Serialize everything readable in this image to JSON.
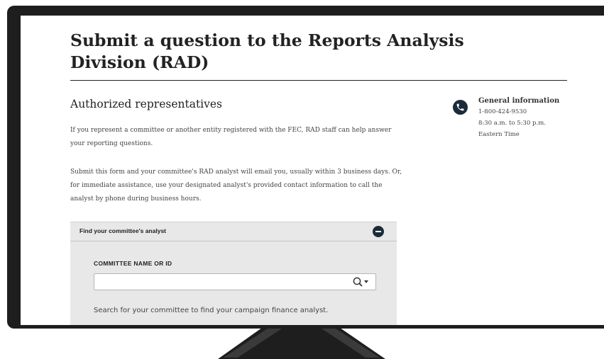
{
  "page": {
    "title": "Submit a question to the Reports Analysis Division (RAD)"
  },
  "section": {
    "heading": "Authorized representatives",
    "paragraphs": [
      "If you represent a committee or another entity registered with the FEC, RAD staff can help answer your reporting questions.",
      "Submit this form and your committee's RAD analyst will email you, usually within 3 business days. Or, for immediate assistance, use your designated analyst's provided contact information to call the analyst by phone during business hours."
    ]
  },
  "contact": {
    "icon": "phone-icon",
    "title": "General information",
    "phone": "1-800-424-9530",
    "hours": "8:30 a.m. to 5:30 p.m.",
    "timezone": "Eastern Time"
  },
  "analyst_panel": {
    "title": "Find your committee's analyst",
    "toggle_icon": "minus-circle-icon",
    "field_label": "COMMITTEE NAME OR ID",
    "search_value": "",
    "search_icon": "search-icon",
    "help_text": "Search for your committee to find your campaign finance analyst."
  },
  "colors": {
    "accent": "#1c2b3a",
    "panel_bg": "#e8e8e8",
    "bezel": "#1e1e1e"
  }
}
